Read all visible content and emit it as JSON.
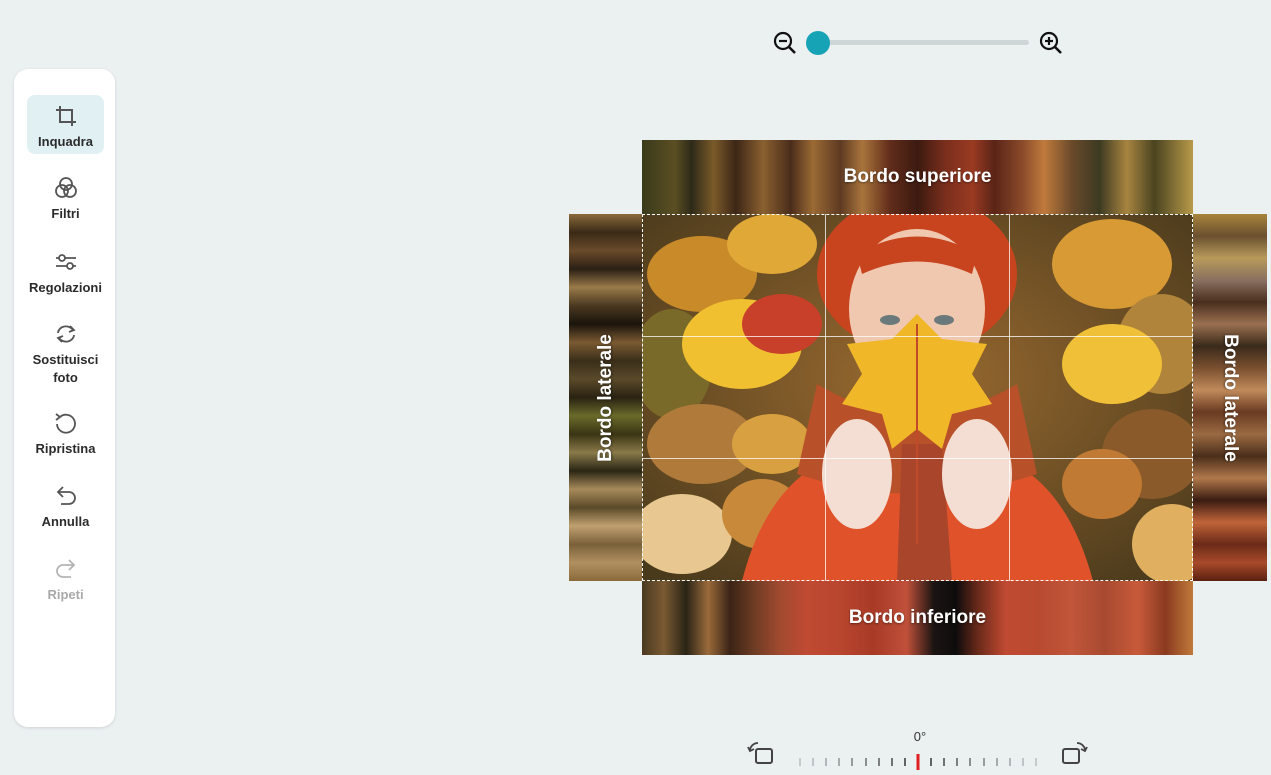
{
  "sidebar": {
    "items": [
      {
        "label": "Inquadra",
        "icon": "crop-icon"
      },
      {
        "label": "Filtri",
        "icon": "filters-icon"
      },
      {
        "label": "Regolazioni",
        "icon": "sliders-icon"
      },
      {
        "label": "Sostituisci foto",
        "icon": "replace-icon"
      },
      {
        "label": "Ripristina",
        "icon": "reset-icon"
      },
      {
        "label": "Annulla",
        "icon": "undo-icon"
      },
      {
        "label": "Ripeti",
        "icon": "redo-icon"
      }
    ],
    "active_index": 0
  },
  "zoom": {
    "level": 0,
    "out_icon": "zoom-out-icon",
    "in_icon": "zoom-in-icon",
    "accent": "#16a3b5"
  },
  "canvas": {
    "top_band_label": "Bordo superiore",
    "bottom_band_label": "Bordo inferiore",
    "left_band_label": "Bordo laterale",
    "right_band_label": "Bordo laterale"
  },
  "rotation": {
    "angle_label": "0°",
    "rotate_left_icon": "rotate-left-icon",
    "rotate_right_icon": "rotate-right-icon",
    "indicator_color": "#e02020"
  }
}
